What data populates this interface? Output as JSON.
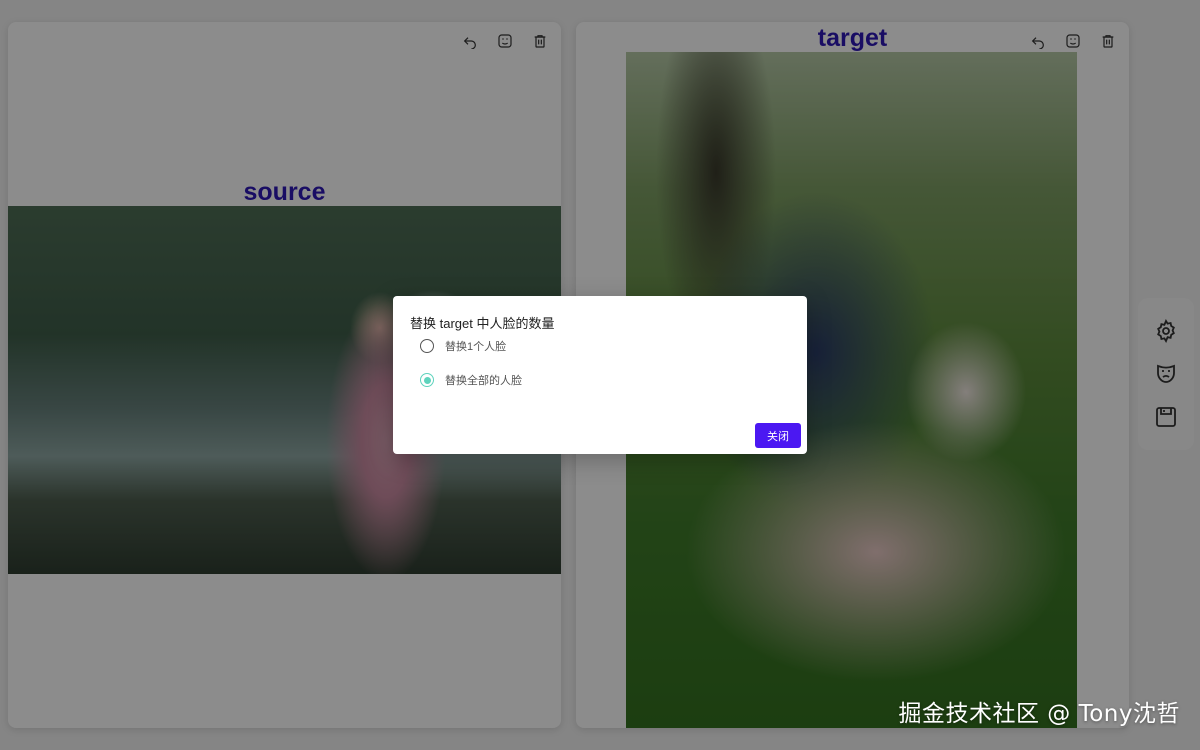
{
  "source_panel": {
    "title": "source"
  },
  "target_panel": {
    "title": "target"
  },
  "panel_tools": [
    "undo-icon",
    "face-mask-icon",
    "trash-icon"
  ],
  "side_toolbar": [
    "gear-icon",
    "theater-mask-icon",
    "save-icon"
  ],
  "modal": {
    "title": "替换 target 中人脸的数量",
    "options": [
      {
        "label": "替换1个人脸",
        "selected": false
      },
      {
        "label": "替换全部的人脸",
        "selected": true
      }
    ],
    "close_label": "关闭"
  },
  "colors": {
    "accent": "#4b18f2",
    "title": "#2f19b6",
    "radio_selected": "#5fd3bd"
  },
  "watermark": "掘金技术社区 @ Tony沈哲"
}
